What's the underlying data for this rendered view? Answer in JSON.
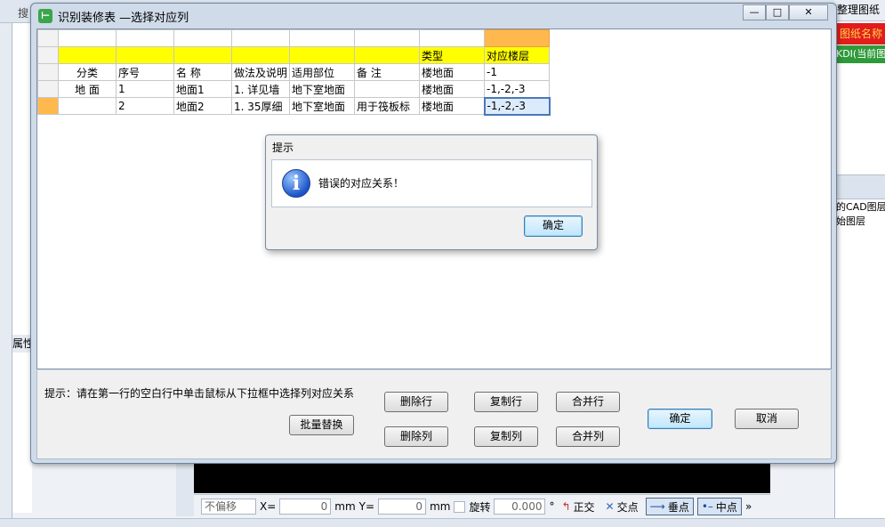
{
  "background": {
    "left_panel_label": "属性",
    "top_left_label": "搜",
    "right_panel": {
      "header": "整理图纸",
      "red_label": "图纸名称",
      "green_label": "KDI(当前图",
      "line1": "的CAD图层",
      "line2": "始图层"
    },
    "statusbar": {
      "offset_select": "不偏移",
      "x_label": "X=",
      "x_value": "0",
      "x_unit": "mm",
      "y_label": "Y=",
      "y_value": "0",
      "y_unit": "mm",
      "rotate_label": "旋转",
      "rotate_value": "0.000",
      "degree": "°",
      "ortho": "正交",
      "intersect": "交点",
      "perp": "垂点",
      "mid": "中点",
      "more": "»"
    }
  },
  "dialog": {
    "title": "识别装修表 —选择对应列",
    "controls": {
      "minimize": "—",
      "maximize": "□",
      "close": "✕"
    },
    "header_row": [
      "",
      "",
      "",
      "",
      "",
      "",
      "类型",
      "对应楼层"
    ],
    "rows": [
      [
        "分类",
        "序号",
        "名  称",
        "做法及说明",
        "适用部位",
        "备    注",
        "楼地面",
        "-1"
      ],
      [
        "地 面",
        "1",
        "地面1",
        "1. 详见墙",
        "地下室地面",
        "",
        "楼地面",
        "-1,-2,-3"
      ],
      [
        "",
        "2",
        "地面2",
        "1. 35厚细",
        "地下室地面",
        "用于筏板标",
        "楼地面",
        "-1,-2,-3"
      ]
    ],
    "hint": "提示：请在第一行的空白行中单击鼠标从下拉框中选择列对应关系",
    "buttons": {
      "batch_replace": "批量替换",
      "delete_row": "删除行",
      "delete_col": "删除列",
      "copy_row": "复制行",
      "copy_col": "复制列",
      "merge_row": "合并行",
      "merge_col": "合并列",
      "ok": "确定",
      "cancel": "取消"
    }
  },
  "message_box": {
    "title": "提示",
    "icon": "info-icon",
    "text": "错误的对应关系！",
    "ok": "确定"
  }
}
